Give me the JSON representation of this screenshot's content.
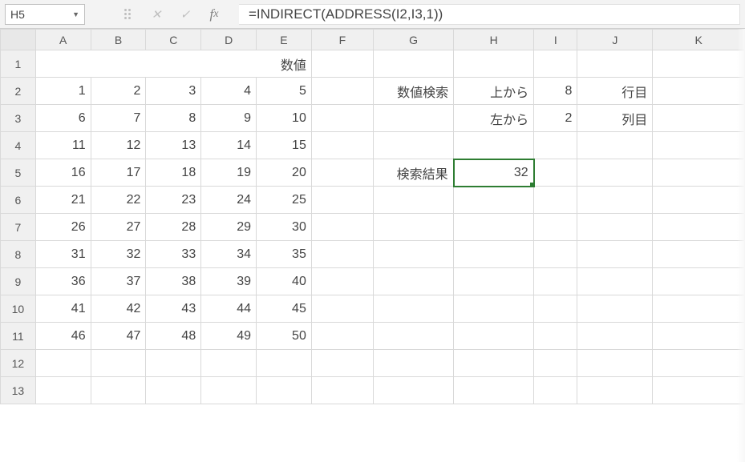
{
  "name_box": {
    "value": "H5"
  },
  "formula_bar": {
    "value": "=INDIRECT(ADDRESS(I2,I3,1))"
  },
  "columns": [
    "A",
    "B",
    "C",
    "D",
    "E",
    "F",
    "G",
    "H",
    "I",
    "J",
    "K"
  ],
  "rows": [
    "1",
    "2",
    "3",
    "4",
    "5",
    "6",
    "7",
    "8",
    "9",
    "10",
    "11",
    "12",
    "13"
  ],
  "selected": {
    "col": "H",
    "row": "5"
  },
  "merged_header": "数値",
  "labels": {
    "G2": "数値検索",
    "H2": "上から",
    "J2": "行目",
    "H3": "左から",
    "J3": "列目",
    "G5": "検索結果"
  },
  "values": {
    "I2": "8",
    "I3": "2",
    "H5": "32"
  },
  "table": {
    "r2": {
      "A": "1",
      "B": "2",
      "C": "3",
      "D": "4",
      "E": "5"
    },
    "r3": {
      "A": "6",
      "B": "7",
      "C": "8",
      "D": "9",
      "E": "10"
    },
    "r4": {
      "A": "11",
      "B": "12",
      "C": "13",
      "D": "14",
      "E": "15"
    },
    "r5": {
      "A": "16",
      "B": "17",
      "C": "18",
      "D": "19",
      "E": "20"
    },
    "r6": {
      "A": "21",
      "B": "22",
      "C": "23",
      "D": "24",
      "E": "25"
    },
    "r7": {
      "A": "26",
      "B": "27",
      "C": "28",
      "D": "29",
      "E": "30"
    },
    "r8": {
      "A": "31",
      "B": "32",
      "C": "33",
      "D": "34",
      "E": "35"
    },
    "r9": {
      "A": "36",
      "B": "37",
      "C": "38",
      "D": "39",
      "E": "40"
    },
    "r10": {
      "A": "41",
      "B": "42",
      "C": "43",
      "D": "44",
      "E": "45"
    },
    "r11": {
      "A": "46",
      "B": "47",
      "C": "48",
      "D": "49",
      "E": "50"
    }
  }
}
